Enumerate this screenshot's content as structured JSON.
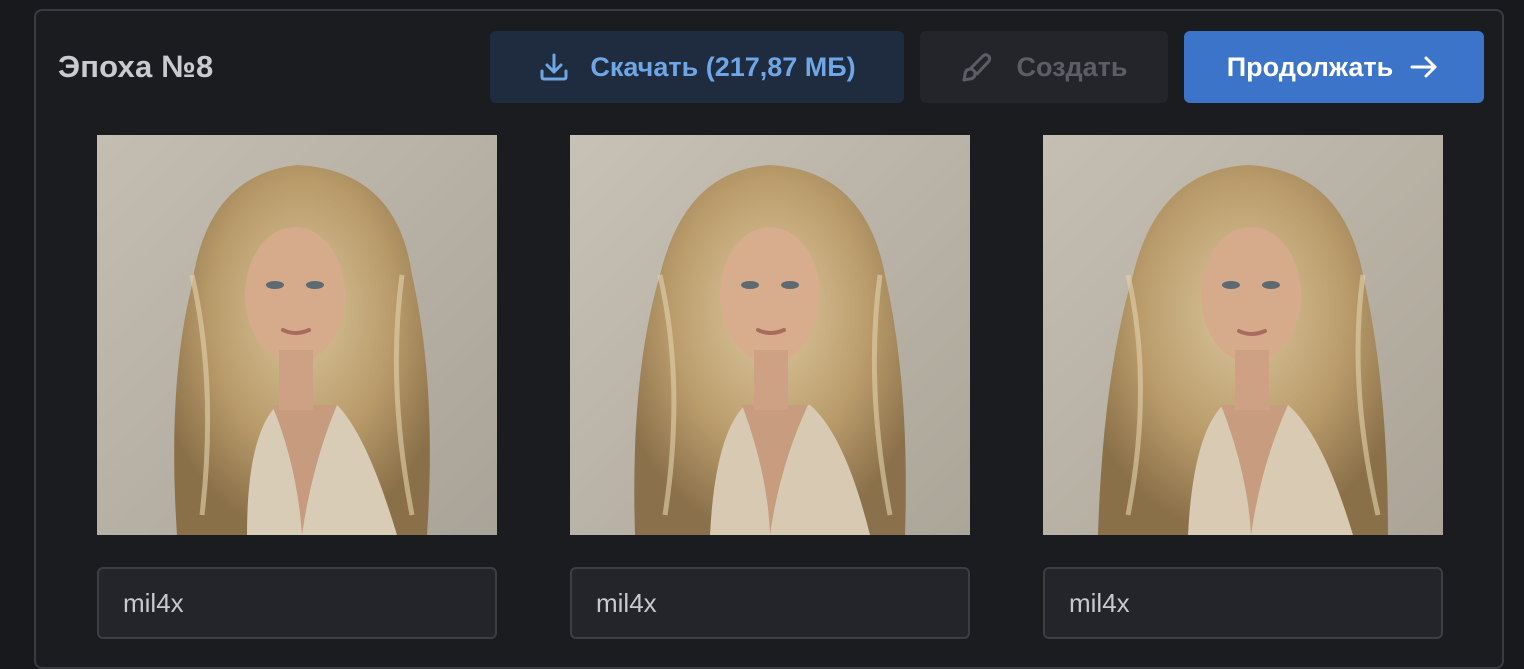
{
  "epoch": {
    "title": "Эпоха №8"
  },
  "toolbar": {
    "download_label": "Скачать (217,87 МБ)",
    "create_label": "Создать",
    "continue_label": "Продолжать",
    "download_icon": "download-icon",
    "create_icon": "brush-icon",
    "continue_icon": "arrow-right-icon"
  },
  "colors": {
    "accent": "#3b74c8",
    "download_bg": "#1f2b3f",
    "download_text": "#6ea6e6",
    "disabled_text": "#5b5e64",
    "background": "#18191d"
  },
  "samples": [
    {
      "caption": "mil4x"
    },
    {
      "caption": "mil4x"
    },
    {
      "caption": "mil4x"
    }
  ]
}
